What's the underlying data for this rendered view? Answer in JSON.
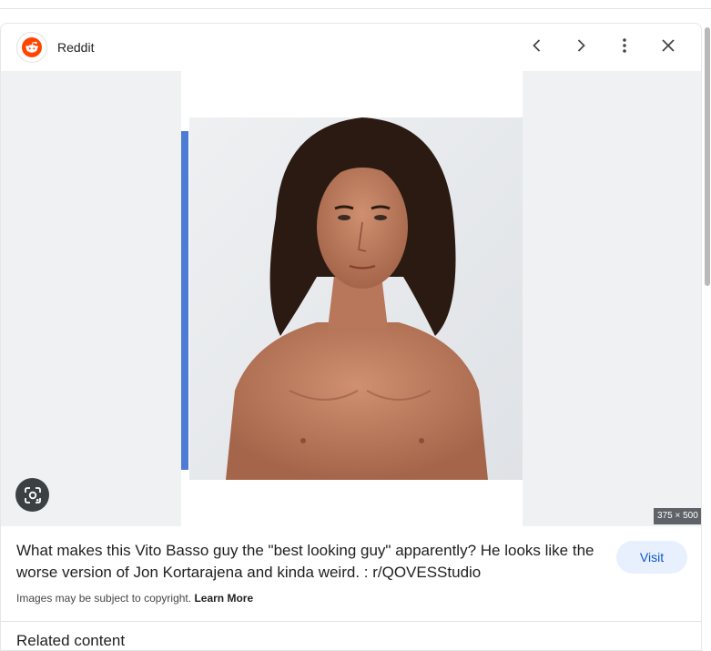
{
  "header": {
    "site_name": "Reddit",
    "logo_icon": "reddit-alien-icon",
    "icons": [
      "chevron-left-icon",
      "chevron-right-icon",
      "more-vert-icon",
      "close-icon"
    ]
  },
  "image": {
    "dimensions_label": "375 × 500",
    "lens_icon": "google-lens-icon",
    "accent_bar_color": "#4e7bd4"
  },
  "result": {
    "title": "What makes this Vito Basso guy the \"best looking guy\" apparently? He looks like the worse version of Jon Kortarajena and kinda weird. : r/QOVESStudio",
    "visit_label": "Visit",
    "copyright_text": "Images may be subject to copyright.",
    "learn_more_label": "Learn More"
  },
  "related": {
    "heading": "Related content"
  },
  "colors": {
    "reddit_orange": "#ff4500",
    "visit_bg": "#e8f0fe",
    "visit_text": "#0b57d0"
  }
}
